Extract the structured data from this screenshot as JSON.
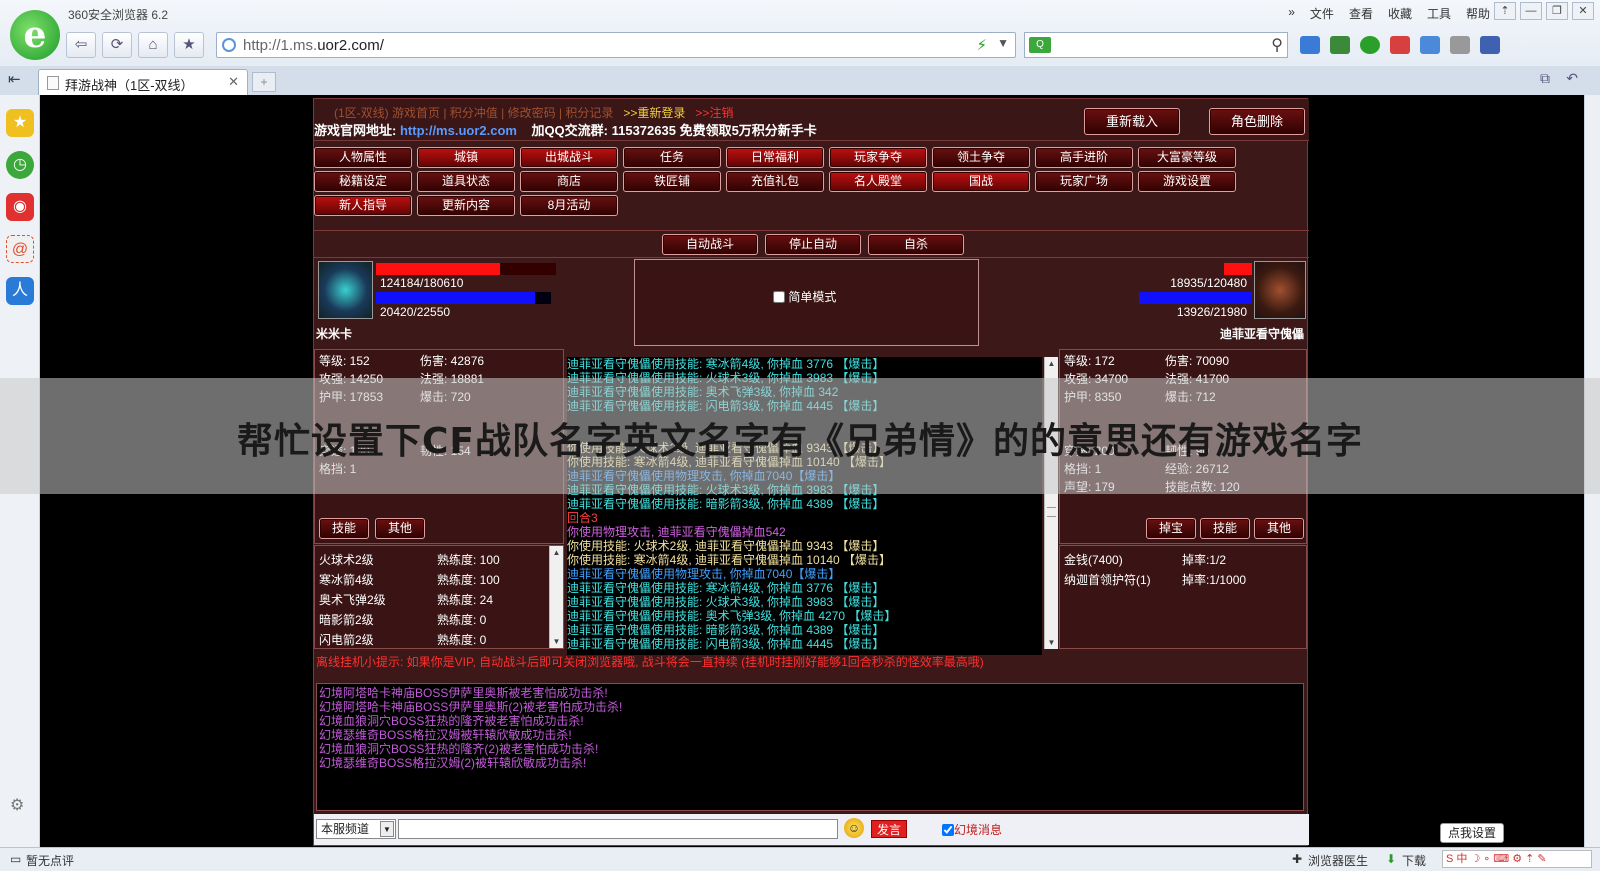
{
  "browser": {
    "title": "360安全浏览器 6.2",
    "menu": [
      "文件",
      "查看",
      "收藏",
      "工具",
      "帮助"
    ],
    "url_prefix": "http://1.ms.",
    "url_domain": "uor2.com/",
    "tab_title": "拜游战神（1区-双线）",
    "status_left": "暂无点评",
    "status_doctor": "浏览器医生",
    "status_download": "下载",
    "help_tip": "点我设置"
  },
  "game": {
    "header_links": "(1区-双线) 游戏首页 | 积分冲值 | 修改密码 | 积分记录",
    "relogin": ">>重新登录",
    "logout": ">>注销",
    "site_label": "游戏官网地址:",
    "site_url": "http://ms.uor2.com",
    "qq_text": "加QQ交流群: 115372635 免费领取5万积分新手卡",
    "reload_btn": "重新载入",
    "delete_btn": "角色删除",
    "menu_row1": [
      "人物属性",
      "城镇",
      "出城战斗",
      "任务",
      "日常福利",
      "玩家争夺",
      "领土争夺",
      "高手进阶",
      "大富豪等级"
    ],
    "menu_row2": [
      "秘籍设定",
      "道具状态",
      "商店",
      "铁匠铺",
      "充值礼包",
      "名人殿堂",
      "国战",
      "玩家广场",
      "游戏设置"
    ],
    "menu_row3": [
      "新人指导",
      "更新内容",
      "8月活动"
    ],
    "auto_fight": "自动战斗",
    "stop_auto": "停止自动",
    "suicide": "自杀",
    "simple_mode": "简单模式",
    "player": {
      "name": "米米卡",
      "hp": "124184/180610",
      "mp": "20420/22550",
      "hp_fraction": 0.69,
      "mp_fraction": 0.91,
      "stats_left": [
        [
          "等级: 152",
          "伤害: 42876"
        ],
        [
          "攻强: 14250",
          "法强: 18881"
        ],
        [
          "护甲: 17853",
          "爆击: 720"
        ],
        [
          "",
          ""
        ],
        [
          "",
          ""
        ],
        [
          "穿透: 188",
          "韧性: 154"
        ],
        [
          "格挡: 1",
          ""
        ]
      ],
      "tab_skill": "技能",
      "tab_other": "其他",
      "skills": [
        [
          "火球术2级",
          "熟练度: 100"
        ],
        [
          "寒冰箭4级",
          "熟练度: 100"
        ],
        [
          "奥术飞弹2级",
          "熟练度: 24"
        ],
        [
          "暗影箭2级",
          "熟练度: 0"
        ],
        [
          "闪电箭2级",
          "熟练度: 0"
        ]
      ]
    },
    "enemy": {
      "name": "迪菲亚看守傀儡",
      "hp": "18935/120480",
      "mp": "13926/21980",
      "hp_fraction": 0.16,
      "mp_fraction": 0.63,
      "stats": [
        [
          "等级: 172",
          "伤害: 70090"
        ],
        [
          "攻强: 34700",
          "法强: 41700"
        ],
        [
          "护甲: 8350",
          "爆击: 712"
        ],
        [
          "",
          ""
        ],
        [
          "",
          ""
        ],
        [
          "穿透: 200",
          "韧性: 90"
        ],
        [
          "格挡: 1",
          "经验: 26712"
        ],
        [
          "声望: 179",
          "技能点数: 120"
        ]
      ],
      "tab_treasure": "掉宝",
      "tab_skill": "技能",
      "tab_other": "其他",
      "drops": [
        [
          "金钱(7400)",
          "掉率:1/2"
        ],
        [
          "纳迦首领护符(1)",
          "掉率:1/1000"
        ]
      ]
    },
    "battle_log": [
      {
        "t": "迪菲亚看守傀儡使用技能: 寒冰箭4级, 你掉血 3776 【爆击】",
        "c": "#40e0e0"
      },
      {
        "t": "迪菲亚看守傀儡使用技能: 火球术3级, 你掉血 3983 【爆击】",
        "c": "#40e0e0"
      },
      {
        "t": "迪菲亚看守傀儡使用技能: 奥术飞弹3级, 你掉血 342",
        "c": "#40e0e0"
      },
      {
        "t": "迪菲亚看守傀儡使用技能: 闪电箭3级, 你掉血 4445 【爆击】",
        "c": "#40e0e0"
      },
      {
        "t": "",
        "c": "#40e0e0"
      },
      {
        "t": "",
        "c": "#40e0e0"
      },
      {
        "t": "你使用技能: 火球术2级, 迪菲亚看守傀儡掉血 9343 【爆击】",
        "c": "#f0e0a0"
      },
      {
        "t": "你使用技能: 寒冰箭4级, 迪菲亚看守傀儡掉血 10140 【爆击】",
        "c": "#f0e0a0"
      },
      {
        "t": "迪菲亚看守傀儡使用物理攻击, 你掉血7040【爆击】",
        "c": "#40a0ff"
      },
      {
        "t": "迪菲亚看守傀儡使用技能: 火球术3级, 你掉血 3983 【爆击】",
        "c": "#40e0e0"
      },
      {
        "t": "迪菲亚看守傀儡使用技能: 暗影箭3级, 你掉血 4389 【爆击】",
        "c": "#40e0e0"
      },
      {
        "t": "回合3",
        "c": "#ff4040"
      },
      {
        "t": "你使用物理攻击, 迪菲亚看守傀儡掉血542",
        "c": "#d060e0"
      },
      {
        "t": "你使用技能: 火球术2级, 迪菲亚看守傀儡掉血 9343 【爆击】",
        "c": "#f0e0a0"
      },
      {
        "t": "你使用技能: 寒冰箭4级, 迪菲亚看守傀儡掉血 10140 【爆击】",
        "c": "#f0e0a0"
      },
      {
        "t": "迪菲亚看守傀儡使用物理攻击, 你掉血7040【爆击】",
        "c": "#40a0ff"
      },
      {
        "t": "迪菲亚看守傀儡使用技能: 寒冰箭4级, 你掉血 3776 【爆击】",
        "c": "#40e0e0"
      },
      {
        "t": "迪菲亚看守傀儡使用技能: 火球术3级, 你掉血 3983 【爆击】",
        "c": "#40e0e0"
      },
      {
        "t": "迪菲亚看守傀儡使用技能: 奥术飞弹3级, 你掉血 4270 【爆击】",
        "c": "#40e0e0"
      },
      {
        "t": "迪菲亚看守傀儡使用技能: 暗影箭3级, 你掉血 4389 【爆击】",
        "c": "#40e0e0"
      },
      {
        "t": "迪菲亚看守傀儡使用技能: 闪电箭3级, 你掉血 4445 【爆击】",
        "c": "#40e0e0"
      }
    ],
    "hint": "离线挂机小提示: 如果你是VIP, 自动战斗后即可关闭浏览器哦, 战斗将会一直持续 (挂机时挂刚好能够1回合秒杀的怪效率最高哦)",
    "chat": [
      "幻境阿塔哈卡神庙BOSS伊萨里奥斯被老害怕成功击杀!",
      "幻境阿塔哈卡神庙BOSS伊萨里奥斯(2)被老害怕成功击杀!",
      "幻境血狼洞穴BOSS狂热的隆齐被老害怕成功击杀!",
      "幻境瑟维奇BOSS格拉汉姆被轩辕欣敏成功击杀!",
      "幻境血狼洞穴BOSS狂热的隆齐(2)被老害怕成功击杀!",
      "幻境瑟维奇BOSS格拉汉姆(2)被轩辕欣敏成功击杀!"
    ],
    "channel": "本服频道",
    "send_btn": "发言",
    "illusion_msg": "幻境消息"
  },
  "overlay_title": "帮忙设置下CF战队名字英文名字有《兄弟情》的的意思还有游戏名字"
}
